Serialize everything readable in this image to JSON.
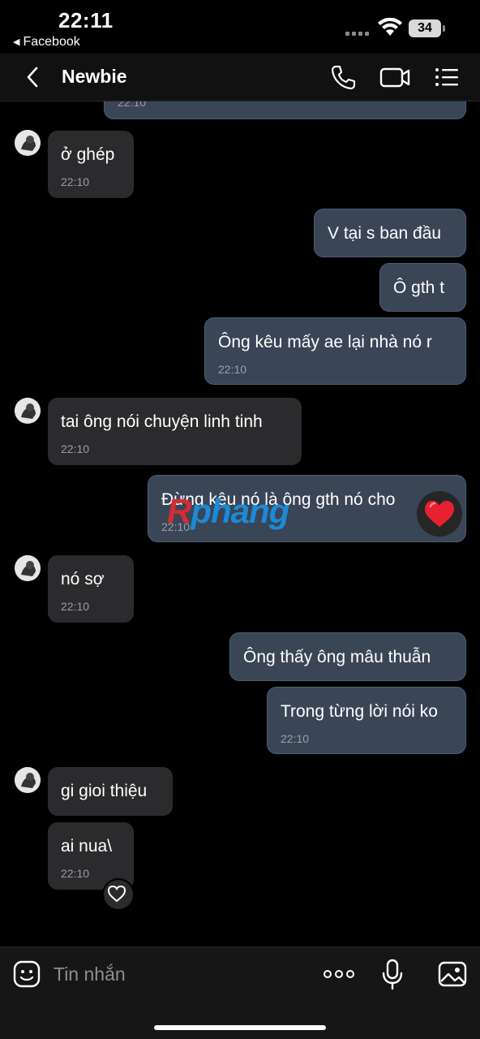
{
  "status_bar": {
    "time": "22:11",
    "back_app": "Facebook",
    "battery": "34"
  },
  "header": {
    "contact_name": "Newbie"
  },
  "messages": [
    {
      "side": "out",
      "text": "",
      "time": "22:10"
    },
    {
      "side": "in",
      "text": "ở ghép",
      "time": "22:10"
    },
    {
      "side": "out",
      "text": "V tại s ban đầu",
      "time": ""
    },
    {
      "side": "out",
      "text": "Ô gth t",
      "time": ""
    },
    {
      "side": "out",
      "text": "Ông kêu mấy ae lại nhà nó r",
      "time": "22:10"
    },
    {
      "side": "in",
      "text": "tai ông nói chuyện linh tinh",
      "time": "22:10"
    },
    {
      "side": "out",
      "text": "Đừng kêu nó là ông gth nó cho",
      "time": "22:10",
      "reaction": "heart"
    },
    {
      "side": "in",
      "text": "nó sợ",
      "time": "22:10"
    },
    {
      "side": "out",
      "text": "Ông thấy ông mâu thuẫn",
      "time": ""
    },
    {
      "side": "out",
      "text": "Trong từng lời nói ko",
      "time": "22:10"
    },
    {
      "side": "in",
      "text": "gi gioi thiệu",
      "time": ""
    },
    {
      "side": "in",
      "text": "ai nua\\",
      "time": "22:10",
      "reaction": "heart-outline"
    }
  ],
  "watermark": {
    "r": "R",
    "rest": "phang"
  },
  "composer": {
    "placeholder": "Tin nhắn"
  },
  "icons": {
    "back": "chevron-left-icon",
    "call": "phone-icon",
    "video": "video-camera-icon",
    "menu": "list-menu-icon",
    "emoji": "emoji-icon",
    "more": "more-dots-icon",
    "mic": "microphone-icon",
    "image": "image-icon"
  },
  "colors": {
    "background": "#000000",
    "incoming_bubble": "#2b2b2d",
    "outgoing_bubble": "#3a4556",
    "reaction_heart": "#e8202f"
  }
}
